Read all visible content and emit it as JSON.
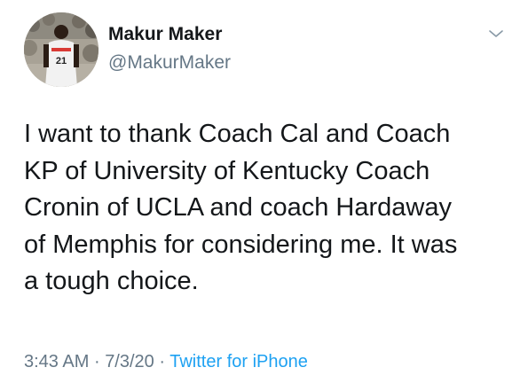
{
  "tweet": {
    "author": {
      "display_name": "Makur Maker",
      "handle": "@MakurMaker",
      "avatar_icon": "profile-photo-icon",
      "jersey_number": "21"
    },
    "menu_icon": "chevron-down-icon",
    "text": "I want to thank Coach Cal and Coach\nKP of University of Kentucky Coach\nCronin of UCLA and coach Hardaway\nof Memphis for considering me. It was\na tough choice.",
    "time": "3:43 AM",
    "date": "7/3/20",
    "separator": "·",
    "source": "Twitter for iPhone"
  },
  "colors": {
    "text": "#14171a",
    "secondary": "#657786",
    "link": "#1da1f2"
  }
}
